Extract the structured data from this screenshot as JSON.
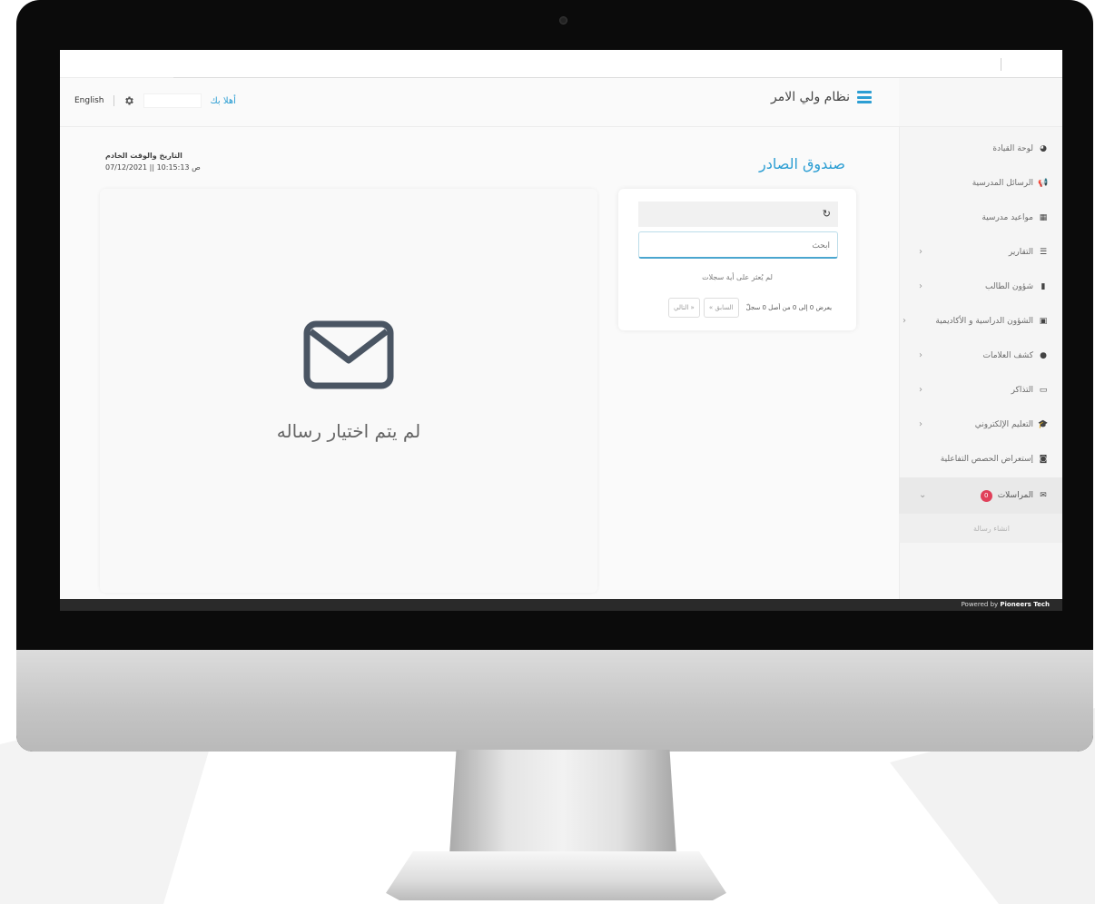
{
  "header": {
    "app_title": "نظام ولي الامر",
    "welcome": "أهلا بك",
    "language": "English"
  },
  "sidebar": {
    "items": [
      {
        "label": "لوحة القيادة",
        "icon": "dashboard-icon"
      },
      {
        "label": "الرسائل المدرسية",
        "icon": "megaphone-icon"
      },
      {
        "label": "مواعيد مدرسية",
        "icon": "calendar-icon"
      },
      {
        "label": "التقارير",
        "icon": "list-icon"
      },
      {
        "label": "شؤون الطالب",
        "icon": "book-icon"
      },
      {
        "label": "الشؤون الدراسية و الأكاديمية",
        "icon": "briefcase-icon"
      },
      {
        "label": "كشف العلامات",
        "icon": "circle-icon"
      },
      {
        "label": "التذاكر",
        "icon": "laptop-icon"
      },
      {
        "label": "التعليم الإلكتروني",
        "icon": "graduation-cap-icon"
      },
      {
        "label": "إستعراض الحصص التفاعلية",
        "icon": "camera-icon"
      },
      {
        "label": "المراسلات",
        "icon": "envelope-icon",
        "badge": "0"
      }
    ],
    "sub_item": "انشاء رسالة"
  },
  "main": {
    "page_title": "صندوق الصادر",
    "server_time_label": "التاريخ والوقت الخادم",
    "server_time_value": "07/12/2021 || 10:15:13 ص",
    "empty_message": "لم يتم اختيار رساله"
  },
  "list": {
    "search_placeholder": "ابحث",
    "no_records": "لم يُعثر على أية سجلات",
    "paging_info": "يعرض 0 إلى 0 من أصل 0 سجلّ",
    "prev_label": "السابق »",
    "next_label": "« التالي"
  },
  "footer": {
    "powered_prefix": "Powered by",
    "powered_brand": "Pioneers Tech"
  },
  "colors": {
    "accent": "#2c9ed3",
    "badge": "#e0405a"
  }
}
